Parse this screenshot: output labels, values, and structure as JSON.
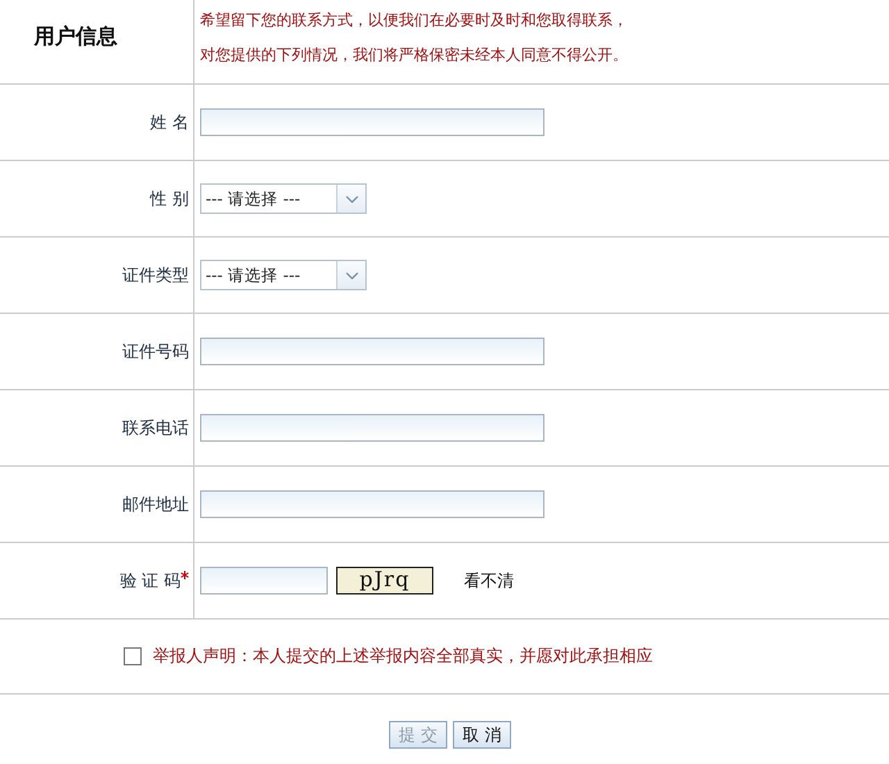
{
  "header": {
    "title": "用户信息",
    "notice": [
      "希望留下您的联系方式，以便我们在必要时及时和您取得联系，",
      "对您提供的下列情况，我们将严格保密未经本人同意不得公开。"
    ]
  },
  "fields": [
    {
      "kind": "text",
      "label": "姓 名"
    },
    {
      "kind": "select",
      "label": "性 别",
      "value": "--- 请选择 ---"
    },
    {
      "kind": "select",
      "label": "证件类型",
      "value": "--- 请选择 ---"
    },
    {
      "kind": "text",
      "label": "证件号码"
    },
    {
      "kind": "text",
      "label": "联系电话"
    },
    {
      "kind": "text",
      "label": "邮件地址"
    },
    {
      "kind": "captcha",
      "label": "验 证 码",
      "required": true,
      "captcha": "pJrq",
      "refresh": "看不清"
    }
  ],
  "declaration": {
    "checked": false,
    "text": "举报人声明：本人提交的上述举报内容全部真实，并愿对此承担相应"
  },
  "buttons": [
    {
      "label": "提 交",
      "disabled": true
    },
    {
      "label": "取 消",
      "disabled": false
    }
  ]
}
